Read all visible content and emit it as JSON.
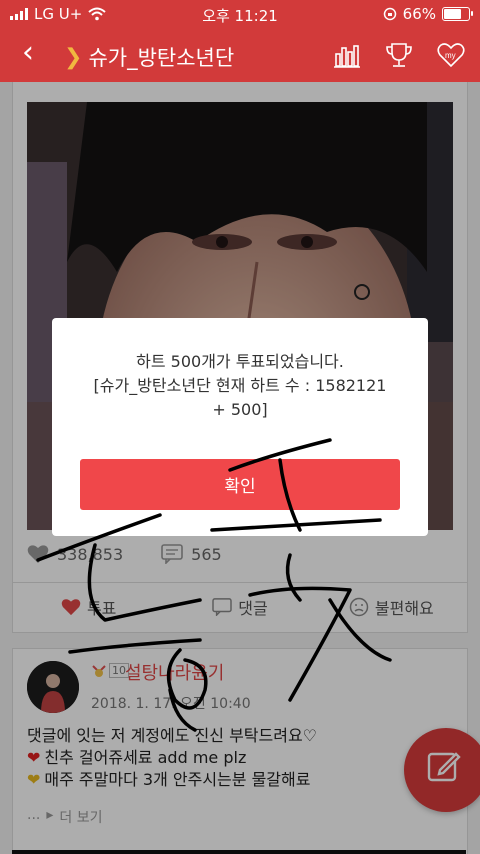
{
  "status_bar": {
    "carrier": "LG U+",
    "time": "오후 11:21",
    "battery": "66%"
  },
  "header": {
    "title": "슈가_방탄소년단"
  },
  "post": {
    "likes": "338,853",
    "comments": "565"
  },
  "actions": {
    "vote": "투표",
    "comment": "댓글",
    "report": "불편해요"
  },
  "comment": {
    "badge": "10",
    "username": "설탕나라윤기",
    "date": "2018. 1. 17. 오전 10:40",
    "line1": "댓글에 잇는 저 계정에도 진신 부탁드려요♡",
    "line2": "친추 걸어쥬세료 add me plz",
    "line3": "매주 주말마다 3개 안주시는분 물갈해료",
    "more": "더 보기"
  },
  "dialog": {
    "line1": "하트 500개가 투표되었습니다.",
    "line2": "[슈가_방탄소년단 현재 하트 수 : 1582121",
    "line3": "+ 500]",
    "confirm": "확인"
  },
  "colors": {
    "header": "#d23a3a",
    "accent": "#f0474a",
    "username": "#e04848"
  }
}
